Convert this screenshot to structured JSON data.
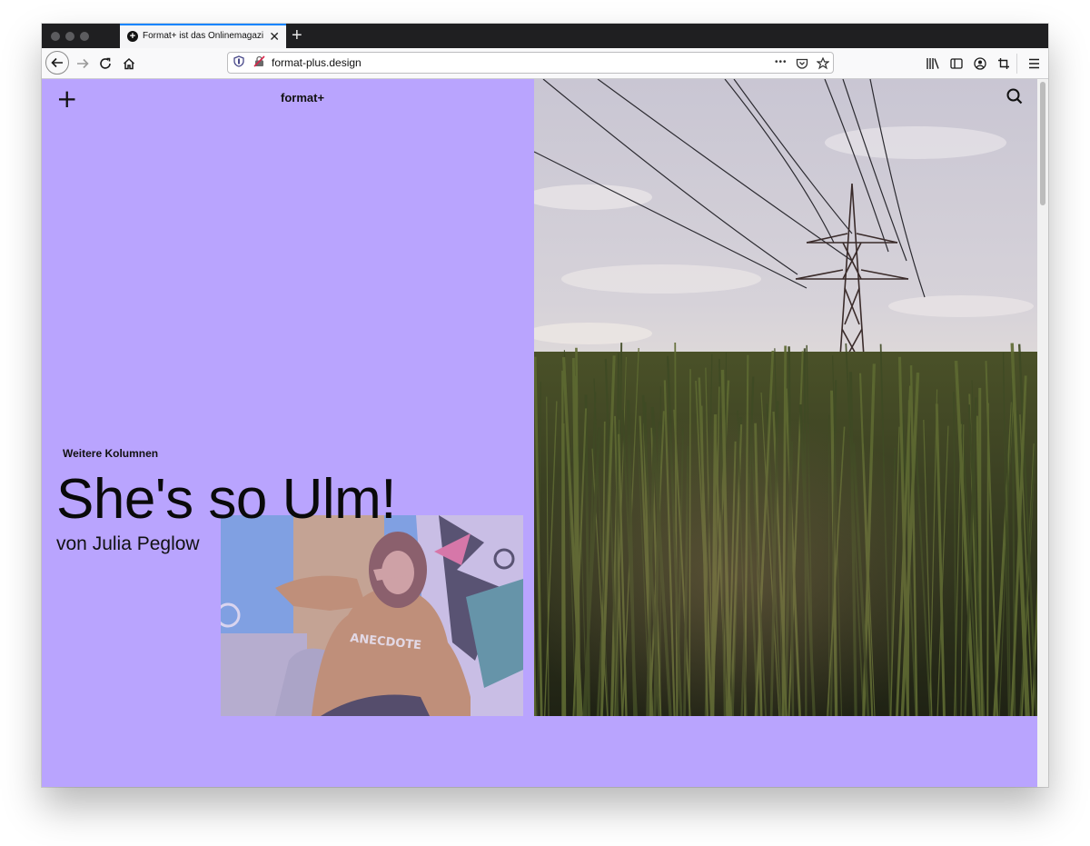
{
  "browser": {
    "tab_title": "Format+ ist das Onlinemagazin",
    "tab_favicon": "+",
    "tab_close": "✕",
    "new_tab": "+",
    "url": "format-plus.design",
    "icons": [
      "back-arrow-icon",
      "forward-arrow-icon",
      "reload-icon",
      "home-icon",
      "shield-icon",
      "insecure-lock-icon",
      "more-dots-icon",
      "pocket-icon",
      "bookmark-star-icon",
      "library-icon",
      "sidebar-icon",
      "account-icon",
      "screenshot-icon",
      "hamburger-menu-icon"
    ],
    "more_dots": "•••"
  },
  "page": {
    "accent_color": "#b9a4fe",
    "menu_plus": "+",
    "logo": "format+",
    "kicker": "Weitere Kolumnen",
    "headline": "She's so Ulm!",
    "byline": "von Julia Peglow",
    "person_sweater_text": "ANECDOTE"
  }
}
